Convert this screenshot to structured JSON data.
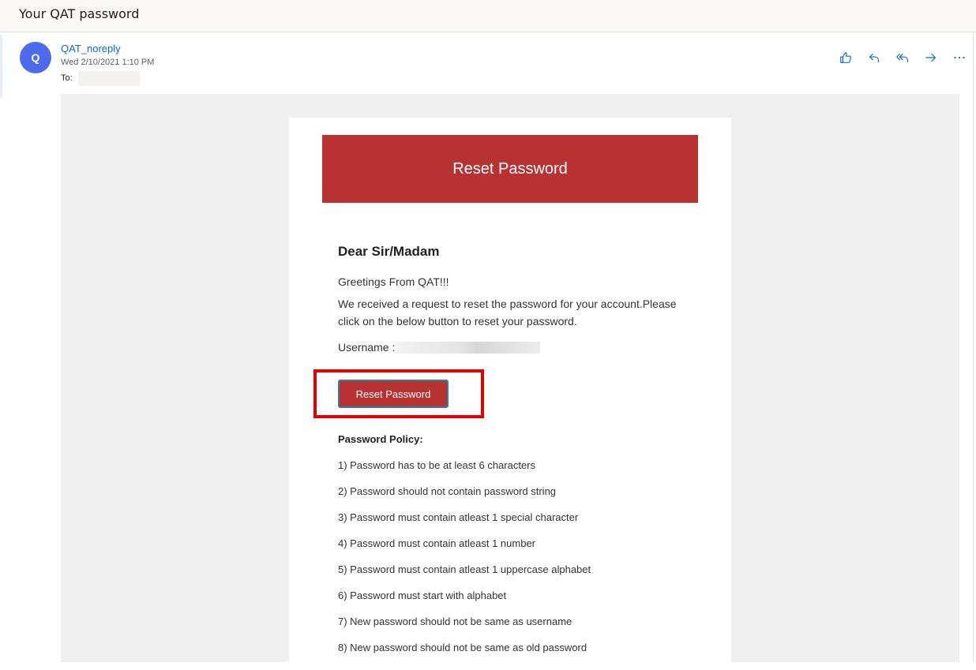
{
  "subject": "Your QAT password",
  "sender": {
    "avatar_letter": "Q",
    "name": "QAT_noreply",
    "date": "Wed 2/10/2021 1:10 PM",
    "to_label": "To:"
  },
  "actions": [
    {
      "icon": "like-icon"
    },
    {
      "icon": "reply-icon"
    },
    {
      "icon": "reply-all-icon"
    },
    {
      "icon": "forward-icon"
    },
    {
      "icon": "more-icon"
    }
  ],
  "email": {
    "header_title": "Reset Password",
    "salutation": "Dear Sir/Madam",
    "greeting": "Greetings From QAT!!!",
    "body": "We received a request to reset the password for your account.Please click on the below button to reset your password.",
    "username_label": "Username :",
    "button_label": "Reset Password",
    "policy_title": "Password Policy:",
    "policies": [
      "1) Password has to be at least 6 characters",
      "2) Password should not contain password string",
      "3) Password must contain atleast 1 special character",
      "4) Password must contain atleast 1 number",
      "5) Password must contain atleast 1 uppercase alphabet",
      "6) Password must start with alphabet",
      "7) New password should not be same as username",
      "8) New password should not be same as old password"
    ]
  },
  "colors": {
    "brand_red": "#b83232",
    "avatar_blue": "#4f6bed",
    "link_blue": "#0f6cbd",
    "highlight_red": "#e50000"
  }
}
